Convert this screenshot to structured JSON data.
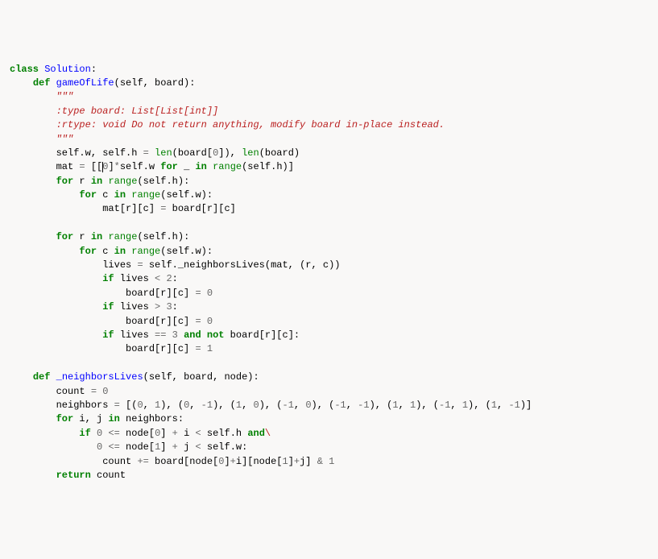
{
  "code": {
    "l1_class": "class",
    "l1_name": "Solution",
    "l1_colon": ":",
    "l2_def": "def",
    "l2_name": "gameOfLife",
    "l2_params": "(self, board):",
    "l3_doc": "\"\"\"",
    "l4_doc": ":type board: List[List[int]]",
    "l5_doc": ":rtype: void Do not return anything, modify board in-place instead.",
    "l6_doc": "\"\"\"",
    "l7_a": "self",
    "l7_b": ".w, self",
    "l7_c": ".h ",
    "l7_eq": "=",
    "l7_len1": "len",
    "l7_d": "(board[",
    "l7_zero": "0",
    "l7_e": "]), ",
    "l7_len2": "len",
    "l7_f": "(board)",
    "l8_a": "mat ",
    "l8_eq": "=",
    "l8_b": " [[",
    "l8_zero": "0",
    "l8_c": "]",
    "l8_star": "*",
    "l8_d": "self",
    "l8_e": ".w ",
    "l8_for": "for",
    "l8_f": " _ ",
    "l8_in": "in",
    "l8_range": "range",
    "l8_g": "(self",
    "l8_h": ".h)]",
    "l9_for": "for",
    "l9_a": " r ",
    "l9_in": "in",
    "l9_range": "range",
    "l9_b": "(self",
    "l9_c": ".h):",
    "l10_for": "for",
    "l10_a": " c ",
    "l10_in": "in",
    "l10_range": "range",
    "l10_b": "(self",
    "l10_c": ".w):",
    "l11_a": "mat[r][c] ",
    "l11_eq": "=",
    "l11_b": " board[r][c]",
    "l12_for": "for",
    "l12_a": " r ",
    "l12_in": "in",
    "l12_range": "range",
    "l12_b": "(self",
    "l12_c": ".h):",
    "l13_for": "for",
    "l13_a": " c ",
    "l13_in": "in",
    "l13_range": "range",
    "l13_b": "(self",
    "l13_c": ".w):",
    "l14_a": "lives ",
    "l14_eq": "=",
    "l14_b": " self",
    "l14_c": "._neighborsLives(mat, (r, c))",
    "l15_if": "if",
    "l15_a": " lives ",
    "l15_lt": "<",
    "l15_two": "2",
    "l15_colon": ":",
    "l16_a": "board[r][c] ",
    "l16_eq": "=",
    "l16_zero": "0",
    "l17_if": "if",
    "l17_a": " lives ",
    "l17_gt": ">",
    "l17_three": "3",
    "l17_colon": ":",
    "l18_a": "board[r][c] ",
    "l18_eq": "=",
    "l18_zero": "0",
    "l19_if": "if",
    "l19_a": " lives ",
    "l19_eqeq": "==",
    "l19_three": "3",
    "l19_and": "and",
    "l19_not": "not",
    "l19_b": " board[r][c]:",
    "l20_a": "board[r][c] ",
    "l20_eq": "=",
    "l20_one": "1",
    "l21_def": "def",
    "l21_name": "_neighborsLives",
    "l21_params": "(self, board, node):",
    "l22_a": "count ",
    "l22_eq": "=",
    "l22_zero": "0",
    "l23_a": "neighbors ",
    "l23_eq": "=",
    "l23_b": " [(",
    "l23_n0": "0",
    "l23_c": ", ",
    "l23_n1": "1",
    "l23_d": "), (",
    "l23_n0b": "0",
    "l23_e": ", ",
    "l23_neg1a": "-",
    "l23_n1b": "1",
    "l23_f": "), (",
    "l23_n1c": "1",
    "l23_g": ", ",
    "l23_n0c": "0",
    "l23_h": "), (",
    "l23_neg1b": "-",
    "l23_n1d": "1",
    "l23_i": ", ",
    "l23_n0d": "0",
    "l23_j": "), (",
    "l23_neg1c": "-",
    "l23_n1e": "1",
    "l23_k": ", ",
    "l23_neg1d": "-",
    "l23_n1f": "1",
    "l23_l": "), (",
    "l23_n1g": "1",
    "l23_m": ", ",
    "l23_n1h": "1",
    "l23_n": "), (",
    "l23_neg1e": "-",
    "l23_n1i": "1",
    "l23_o": ", ",
    "l23_n1j": "1",
    "l23_p": "), (",
    "l23_n1k": "1",
    "l23_q": ", ",
    "l23_neg1f": "-",
    "l23_n1l": "1",
    "l23_r": ")]",
    "l24_for": "for",
    "l24_a": " i, j ",
    "l24_in": "in",
    "l24_b": " neighbors:",
    "l25_if": "if",
    "l25_zero": "0",
    "l25_le": "<=",
    "l25_a": " node[",
    "l25_zerob": "0",
    "l25_b": "] ",
    "l25_plus": "+",
    "l25_c": " i ",
    "l25_lt": "<",
    "l25_d": " self",
    "l25_e": ".h ",
    "l25_and": "and",
    "l25_bs": "\\",
    "l26_zero": "0",
    "l26_le": "<=",
    "l26_a": " node[",
    "l26_one": "1",
    "l26_b": "] ",
    "l26_plus": "+",
    "l26_c": " j ",
    "l26_lt": "<",
    "l26_d": " self",
    "l26_e": ".w:",
    "l27_a": "count ",
    "l27_peq": "+=",
    "l27_b": " board[node[",
    "l27_zero": "0",
    "l27_c": "]",
    "l27_plus1": "+",
    "l27_d": "i][node[",
    "l27_one": "1",
    "l27_e": "]",
    "l27_plus2": "+",
    "l27_f": "j] ",
    "l27_amp": "&",
    "l27_oneb": "1",
    "l28_return": "return",
    "l28_a": " count"
  }
}
